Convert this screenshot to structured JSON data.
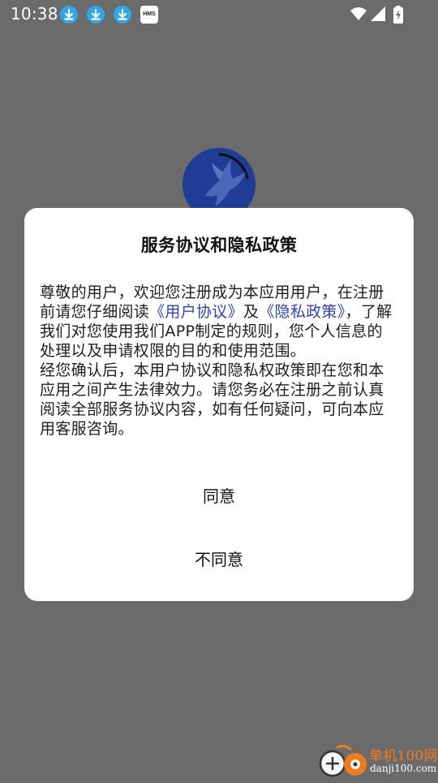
{
  "status_bar": {
    "time": "10:38",
    "notification_icons": [
      "download-icon",
      "download-icon",
      "download-icon"
    ],
    "hms_label": "HMS",
    "right_icons": [
      "wifi-icon",
      "cell-signal-icon",
      "battery-charging-icon"
    ]
  },
  "dialog": {
    "title": "服务协议和隐私政策",
    "body": {
      "p1_part1": "尊敬的用户，欢迎您注册成为本应用用户，在注册前请您仔细阅读",
      "link_user_agreement": "《用户协议》",
      "p1_part2": "及",
      "link_privacy_policy": "《隐私政策》",
      "p1_part3": "，了解我们对您使用我们APP制定的规则，您个人信息的处理以及申请权限的目的和使用范围。",
      "p2": "经您确认后，本用户协议和隐私权政策即在您和本应用之间产生法律效力。请您务必在注册之前认真阅读全部服务协议内容，如有任何疑问，可向本应用客服咨询。"
    },
    "agree_label": "同意",
    "disagree_label": "不同意",
    "link_color": "#2b3fc9"
  },
  "watermark": {
    "name": "单机100网",
    "url": "danji100.com"
  },
  "colors": {
    "overlay_background": "#6b6b6b",
    "dialog_background": "#ffffff",
    "logo_blue": "#1f3d96",
    "download_icon_blue": "#2fa7e8",
    "watermark_orange": "#f07b19"
  }
}
